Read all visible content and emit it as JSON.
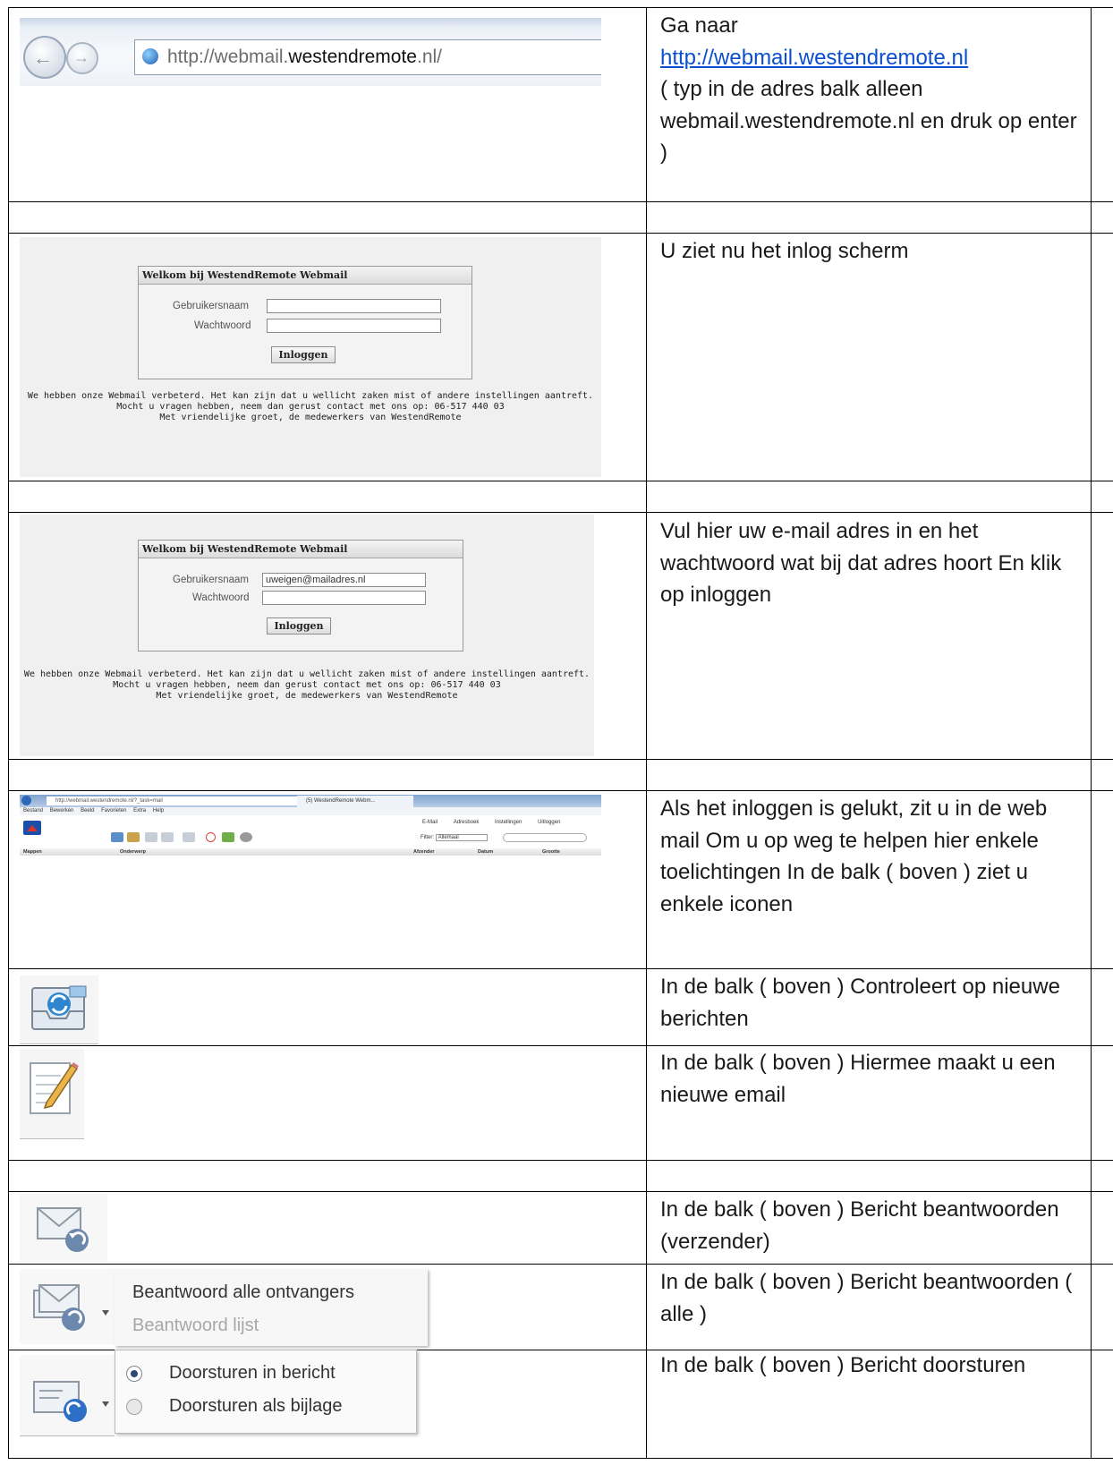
{
  "rows": [
    {
      "browser": {
        "url_prefix": "http://webmail.",
        "url_domain": "westendremote",
        "url_suffix": ".nl/"
      },
      "text": {
        "line1": "Ga naar",
        "link": "http://webmail.westendremote.nl",
        "line3": "( typ in de adres balk alleen webmail.westendremote.nl en druk op enter )"
      }
    },
    {
      "login": {
        "title": "Welkom bij WestendRemote Webmail",
        "username_label": "Gebruikersnaam",
        "password_label": "Wachtwoord",
        "username_value": "",
        "button": "Inloggen",
        "notice1": "We hebben onze Webmail verbeterd. Het kan zijn dat u wellicht zaken mist of andere instellingen aantreft.",
        "notice2": "Mocht u vragen hebben, neem dan gerust contact met ons op: 06-517 440 03",
        "notice3": "Met vriendelijke groet, de medewerkers van WestendRemote"
      },
      "text": "U ziet nu het inlog scherm"
    },
    {
      "login": {
        "title": "Welkom bij WestendRemote Webmail",
        "username_label": "Gebruikersnaam",
        "password_label": "Wachtwoord",
        "username_value": "uweigen@mailadres.nl",
        "button": "Inloggen",
        "notice1": "We hebben onze Webmail verbeterd. Het kan zijn dat u wellicht zaken mist of andere instellingen aantreft.",
        "notice2": "Mocht u vragen hebben, neem dan gerust contact met ons op: 06-517 440 03",
        "notice3": "Met vriendelijke groet, de medewerkers van WestendRemote"
      },
      "text": "Vul hier uw e-mail adres in en het wachtwoord wat bij dat adres hoort En klik op inloggen"
    },
    {
      "webmail": {
        "address": "http://webmail.westendremote.nl/?_task=mail",
        "tab": "(5) WestendRemote Webm...",
        "menu": [
          "Bestand",
          "Bewerken",
          "Beeld",
          "Favorieten",
          "Extra",
          "Help"
        ],
        "top_links": [
          "E-Mail",
          "Adresboek",
          "Instellingen",
          "Uitloggen"
        ],
        "filter_label": "Filter:",
        "filter_value": "Allemaal",
        "col_folders": "Mappen",
        "col_subject": "Onderwerp",
        "col_sender": "Afzender",
        "col_date": "Datum",
        "col_size": "Grootte"
      },
      "text": "Als het inloggen is gelukt, zit u in de web mail Om u op weg te helpen hier enkele toelichtingen In de balk ( boven ) ziet u enkele iconen"
    },
    {
      "icon": "check-mail-icon",
      "text": "In de balk ( boven ) Controleert op nieuwe berichten"
    },
    {
      "icon": "compose-icon",
      "text": "In de balk ( boven ) Hiermee maakt u een nieuwe email"
    },
    {
      "icon": "reply-icon",
      "text": "In de balk ( boven ) Bericht beantwoorden (verzender)"
    },
    {
      "icon": "reply-all-icon",
      "menu": [
        "Beantwoord alle ontvangers",
        "Beantwoord lijst"
      ],
      "text": "In de balk ( boven ) Bericht beantwoorden ( alle )"
    },
    {
      "icon": "forward-icon",
      "menu": [
        "Doorsturen in bericht",
        "Doorsturen als bijlage"
      ],
      "text": "In de balk ( boven ) Bericht doorsturen"
    }
  ]
}
